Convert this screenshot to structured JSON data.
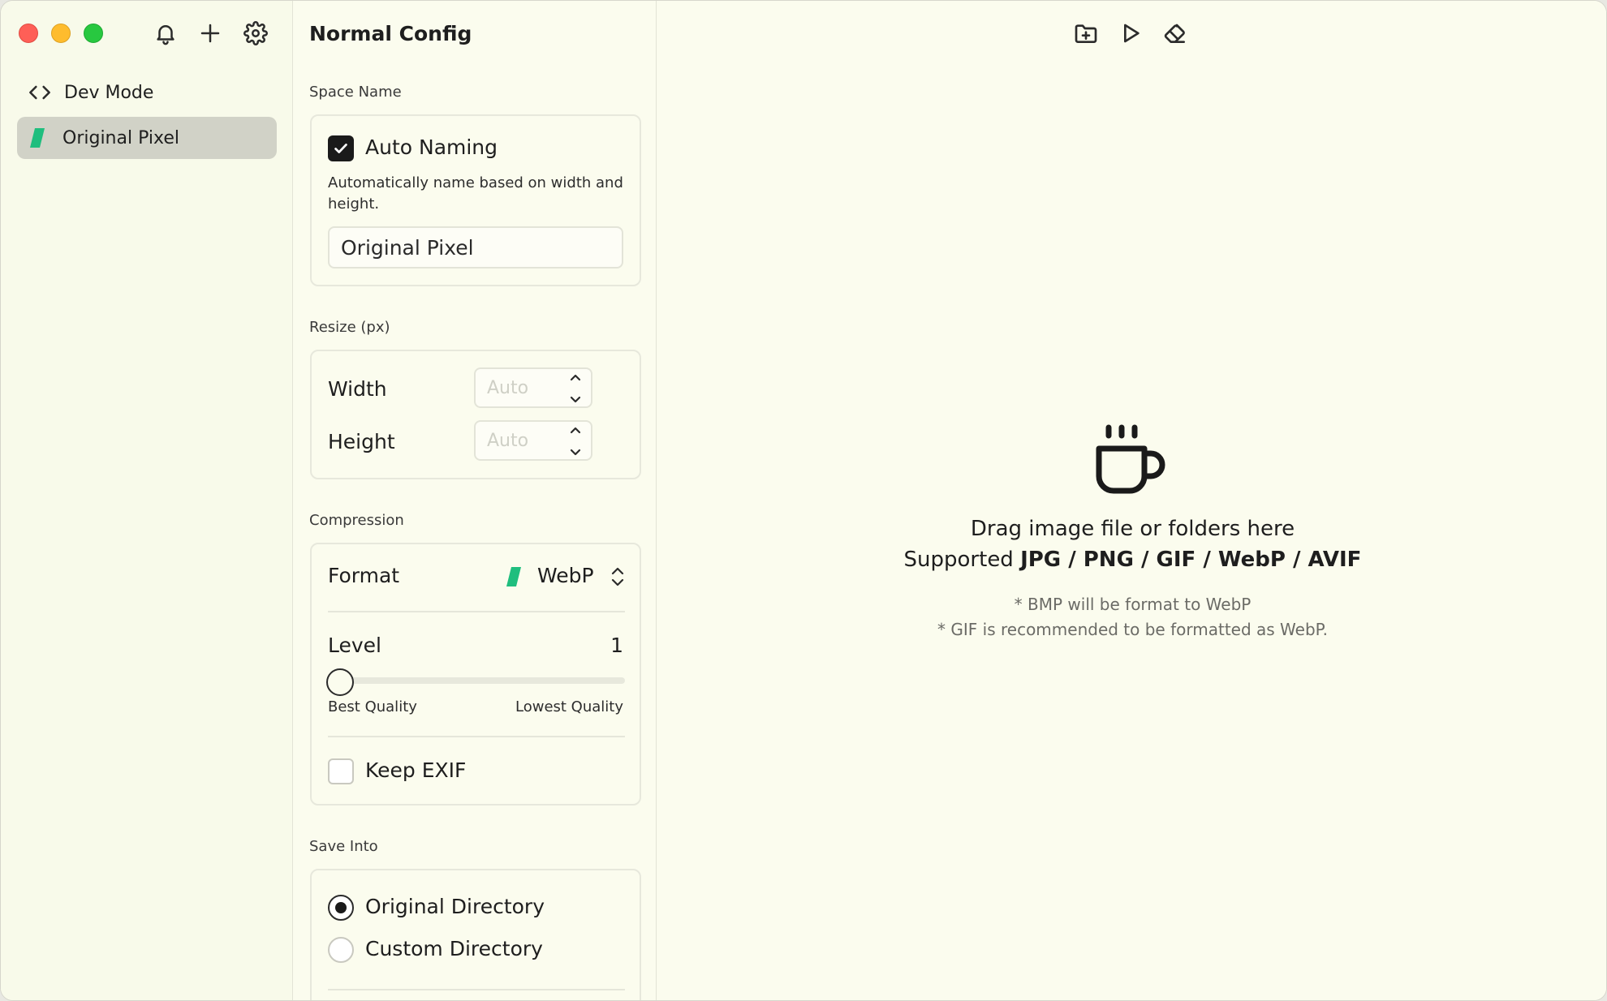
{
  "sidebar": {
    "items": [
      {
        "label": "Dev Mode",
        "icon": "code-brackets-icon"
      },
      {
        "label": "Original Pixel",
        "icon": "webp-swatch-icon",
        "selected": true
      }
    ],
    "toolbar_icons": [
      "bell-icon",
      "plus-icon",
      "gear-icon"
    ]
  },
  "config": {
    "title": "Normal Config",
    "space_name": {
      "label": "Space Name",
      "auto_naming_label": "Auto Naming",
      "auto_naming_checked": true,
      "description": "Automatically name based on width and height.",
      "name_value": "Original Pixel"
    },
    "resize": {
      "label": "Resize (px)",
      "width_label": "Width",
      "width_placeholder": "Auto",
      "height_label": "Height",
      "height_placeholder": "Auto"
    },
    "compression": {
      "label": "Compression",
      "format_label": "Format",
      "format_value": "WebP",
      "level_label": "Level",
      "level_value": "1",
      "level_fraction": 0,
      "min_label": "Best Quality",
      "max_label": "Lowest Quality",
      "keep_exif_label": "Keep EXIF",
      "keep_exif_checked": false
    },
    "save_into": {
      "label": "Save Into",
      "options": [
        {
          "label": "Original Directory",
          "selected": true
        },
        {
          "label": "Custom Directory",
          "selected": false
        }
      ]
    }
  },
  "main": {
    "toolbar_icons": [
      "folder-add-icon",
      "play-icon",
      "eraser-icon"
    ],
    "drop_title": "Drag image file or folders here",
    "supported_prefix": "Supported",
    "supported_formats": "JPG / PNG / GIF / WebP / AVIF",
    "notes": [
      "* BMP will be format to WebP",
      "* GIF is recommended to be formatted as WebP."
    ]
  },
  "colors": {
    "background": "#fbfcee",
    "selected_item": "#d1d2c7",
    "webp_green": "#1fbe7e",
    "dark": "#1a1a1a"
  }
}
